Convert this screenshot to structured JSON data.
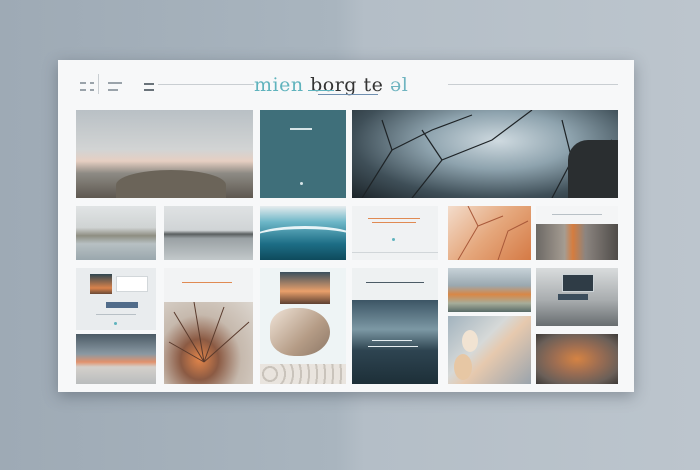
{
  "header": {
    "brand_part1": "mien",
    "brand_part2": " borg",
    "brand_part3": "te",
    "brand_part4": "ǝl"
  },
  "colors": {
    "accent": "#5fb3bd",
    "panel": "#f7f8f9",
    "teal_tile": "#3f6f7a",
    "sunset": "#e08a52"
  },
  "tiles": [
    {
      "name": "misty-shore-photo"
    },
    {
      "name": "teal-placeholder-card"
    },
    {
      "name": "frosted-trees-photo"
    },
    {
      "name": "reeds-lake-photo"
    },
    {
      "name": "calm-water-photo"
    },
    {
      "name": "wave-photo"
    },
    {
      "name": "text-card"
    },
    {
      "name": "autumn-branches-photo"
    },
    {
      "name": "rocks-photo"
    },
    {
      "name": "window-card"
    },
    {
      "name": "root-texture-photo"
    },
    {
      "name": "sunset-sand-photo"
    },
    {
      "name": "mountain-card"
    },
    {
      "name": "dunes-photo"
    },
    {
      "name": "screen-card"
    },
    {
      "name": "sunset-shore-photo"
    },
    {
      "name": "shells-photo"
    },
    {
      "name": "orange-leaves-photo"
    }
  ]
}
